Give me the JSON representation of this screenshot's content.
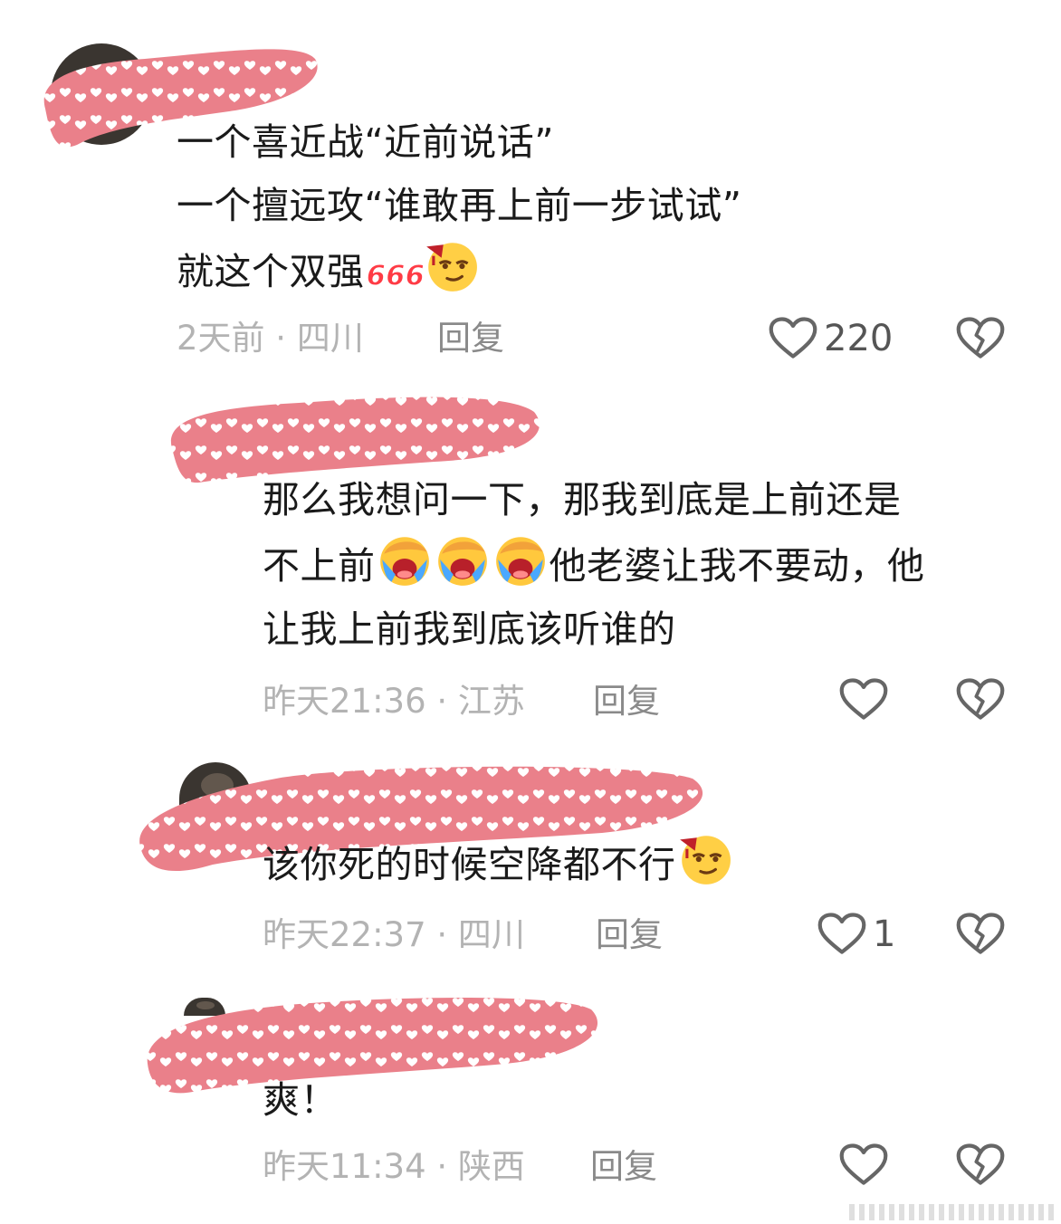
{
  "colors": {
    "redact_fill": "#ea808a",
    "meta_text": "#b3b3b3",
    "reply_text": "#8a8a8a",
    "body_text": "#1a1a1a"
  },
  "comments": [
    {
      "lines": [
        "一个喜近战“近前说话”",
        "一个擅远攻“谁敢再上前一步试试”",
        "就这个双强"
      ],
      "trailing_emojis": [
        "666-emoji",
        "wine-smirk-emoji"
      ],
      "meta": "2天前 · 四川",
      "reply": "回复",
      "likes": "220"
    },
    {
      "lines": [
        "那么我想问一下，那我到底是上前还是",
        "不上前",
        "他老婆让我不要动，他",
        "让我上前我到底该听谁的"
      ],
      "inline_emojis": [
        "facepalm-cry-emoji",
        "facepalm-cry-emoji",
        "facepalm-cry-emoji"
      ],
      "meta": "昨天21:36 · 江苏",
      "reply": "回复",
      "likes": ""
    },
    {
      "lines": [
        "该你死的时候空降都不行"
      ],
      "trailing_emojis": [
        "wine-smirk-emoji"
      ],
      "meta": "昨天22:37 · 四川",
      "reply": "回复",
      "likes": "1"
    },
    {
      "lines": [
        "爽！"
      ],
      "meta": "昨天11:34 · 陕西",
      "reply": "回复",
      "likes": ""
    }
  ]
}
